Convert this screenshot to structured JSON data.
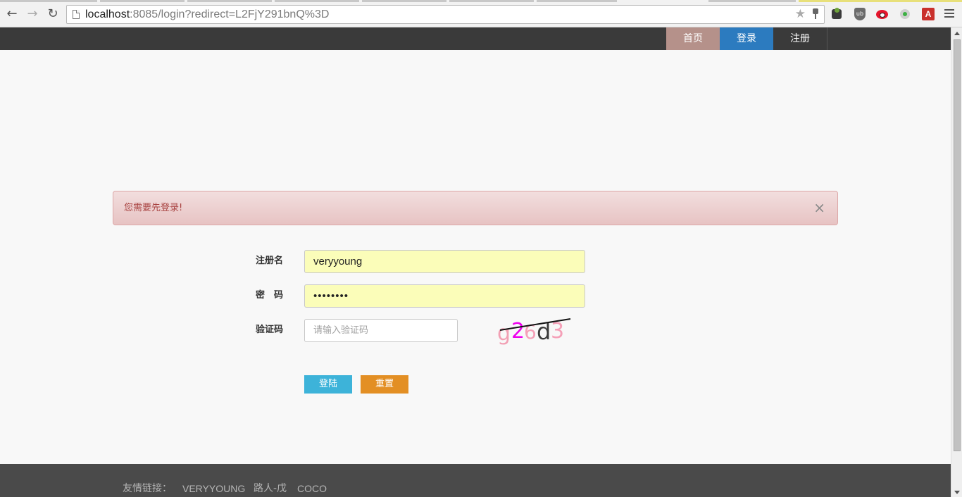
{
  "browser": {
    "url_host": "localhost",
    "url_path": ":8085/login?redirect=L2FjY291bnQ%3D"
  },
  "navbar": {
    "home": "首页",
    "login": "登录",
    "register": "注册",
    "colors": {
      "home": "#b5918a",
      "login": "#2c7bbf",
      "bar": "#3a3a3a"
    }
  },
  "alert": {
    "message": "您需要先登录!",
    "close": "×"
  },
  "form": {
    "username_label": "注册名",
    "username_value": "veryyoung",
    "password_label": "密　码",
    "password_value": "••••••••",
    "captcha_label": "验证码",
    "captcha_placeholder": "请输入验证码",
    "captcha_chars": [
      "g",
      "2",
      "6",
      "d",
      "3"
    ],
    "submit": "登陆",
    "reset": "重置"
  },
  "footer": {
    "label": "友情链接：",
    "links": [
      "VERYYOUNG",
      "路人-戊",
      "COCO"
    ]
  }
}
